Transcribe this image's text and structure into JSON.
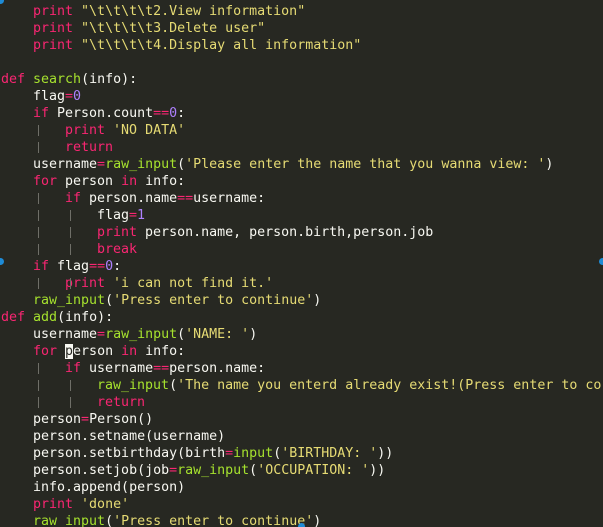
{
  "lines": [
    {
      "indent": 1,
      "guides": [],
      "tokens": [
        {
          "t": "print ",
          "c": "kw"
        },
        {
          "t": "\"\\t\\t\\t\\t2.View information\"",
          "c": "str"
        }
      ]
    },
    {
      "indent": 1,
      "guides": [],
      "tokens": [
        {
          "t": "print ",
          "c": "kw"
        },
        {
          "t": "\"\\t\\t\\t\\t3.Delete user\"",
          "c": "str"
        }
      ]
    },
    {
      "indent": 1,
      "guides": [],
      "tokens": [
        {
          "t": "print ",
          "c": "kw"
        },
        {
          "t": "\"\\t\\t\\t\\t4.Display all information\"",
          "c": "str"
        }
      ]
    },
    {
      "indent": 0,
      "guides": [],
      "tokens": []
    },
    {
      "indent": 0,
      "guides": [],
      "tokens": [
        {
          "t": "def ",
          "c": "kw"
        },
        {
          "t": "search",
          "c": "fn"
        },
        {
          "t": "(info):",
          "c": ""
        }
      ]
    },
    {
      "indent": 1,
      "guides": [],
      "tokens": [
        {
          "t": "flag",
          "c": ""
        },
        {
          "t": "=",
          "c": "kw"
        },
        {
          "t": "0",
          "c": "num"
        }
      ]
    },
    {
      "indent": 1,
      "guides": [],
      "tokens": [
        {
          "t": "if ",
          "c": "kw"
        },
        {
          "t": "Person.count",
          "c": ""
        },
        {
          "t": "==",
          "c": "kw"
        },
        {
          "t": "0",
          "c": "num"
        },
        {
          "t": ":",
          "c": ""
        }
      ]
    },
    {
      "indent": 2,
      "guides": [
        1
      ],
      "tokens": [
        {
          "t": "print ",
          "c": "kw"
        },
        {
          "t": "'NO DATA'",
          "c": "str"
        }
      ]
    },
    {
      "indent": 2,
      "guides": [
        1
      ],
      "tokens": [
        {
          "t": "return",
          "c": "kw"
        }
      ]
    },
    {
      "indent": 1,
      "guides": [],
      "tokens": [
        {
          "t": "username",
          "c": ""
        },
        {
          "t": "=",
          "c": "kw"
        },
        {
          "t": "raw_input",
          "c": "bi"
        },
        {
          "t": "(",
          "c": ""
        },
        {
          "t": "'Please enter the name that you wanna view: '",
          "c": "str"
        },
        {
          "t": ")",
          "c": ""
        }
      ]
    },
    {
      "indent": 1,
      "guides": [],
      "tokens": [
        {
          "t": "for ",
          "c": "kw"
        },
        {
          "t": "person ",
          "c": ""
        },
        {
          "t": "in ",
          "c": "kw"
        },
        {
          "t": "info:",
          "c": ""
        }
      ]
    },
    {
      "indent": 2,
      "guides": [
        1
      ],
      "tokens": [
        {
          "t": "if ",
          "c": "kw"
        },
        {
          "t": "person.name",
          "c": ""
        },
        {
          "t": "==",
          "c": "kw"
        },
        {
          "t": "username:",
          "c": ""
        }
      ]
    },
    {
      "indent": 3,
      "guides": [
        1,
        2
      ],
      "tokens": [
        {
          "t": "flag",
          "c": ""
        },
        {
          "t": "=",
          "c": "kw"
        },
        {
          "t": "1",
          "c": "num"
        }
      ]
    },
    {
      "indent": 3,
      "guides": [
        1,
        2
      ],
      "tokens": [
        {
          "t": "print ",
          "c": "kw"
        },
        {
          "t": "person.name, person.birth,person.job",
          "c": ""
        }
      ]
    },
    {
      "indent": 3,
      "guides": [
        1,
        2
      ],
      "tokens": [
        {
          "t": "break",
          "c": "kw"
        }
      ]
    },
    {
      "indent": 1,
      "guides": [],
      "tokens": [
        {
          "t": "if ",
          "c": "kw"
        },
        {
          "t": "flag",
          "c": ""
        },
        {
          "t": "==",
          "c": "kw"
        },
        {
          "t": "0",
          "c": "num"
        },
        {
          "t": ":",
          "c": ""
        }
      ]
    },
    {
      "indent": 2,
      "guides": [
        1,
        2
      ],
      "tokens": [
        {
          "t": "print ",
          "c": "kw"
        },
        {
          "t": "'i can not find it.'",
          "c": "str"
        }
      ]
    },
    {
      "indent": 1,
      "guides": [],
      "tokens": [
        {
          "t": "raw_input",
          "c": "bi"
        },
        {
          "t": "(",
          "c": ""
        },
        {
          "t": "'Press enter to continue'",
          "c": "str"
        },
        {
          "t": ")",
          "c": ""
        }
      ]
    },
    {
      "indent": 0,
      "guides": [],
      "tokens": [
        {
          "t": "def ",
          "c": "kw"
        },
        {
          "t": "add",
          "c": "fn"
        },
        {
          "t": "(info):",
          "c": ""
        }
      ]
    },
    {
      "indent": 1,
      "guides": [],
      "tokens": [
        {
          "t": "username",
          "c": ""
        },
        {
          "t": "=",
          "c": "kw"
        },
        {
          "t": "raw_input",
          "c": "bi"
        },
        {
          "t": "(",
          "c": ""
        },
        {
          "t": "'NAME: '",
          "c": "str"
        },
        {
          "t": ")",
          "c": ""
        }
      ]
    },
    {
      "indent": 1,
      "guides": [],
      "tokens": [
        {
          "t": "for ",
          "c": "kw"
        },
        {
          "t": "p",
          "c": "cursor"
        },
        {
          "t": "erson ",
          "c": ""
        },
        {
          "t": "in ",
          "c": "kw"
        },
        {
          "t": "info:",
          "c": ""
        }
      ]
    },
    {
      "indent": 2,
      "guides": [
        1
      ],
      "tokens": [
        {
          "t": "if ",
          "c": "kw"
        },
        {
          "t": "username",
          "c": ""
        },
        {
          "t": "==",
          "c": "kw"
        },
        {
          "t": "person.name:",
          "c": ""
        }
      ]
    },
    {
      "indent": 3,
      "guides": [
        1,
        2
      ],
      "tokens": [
        {
          "t": "raw_input",
          "c": "bi"
        },
        {
          "t": "(",
          "c": ""
        },
        {
          "t": "'The name you enterd already exist!(Press enter to co",
          "c": "str"
        }
      ]
    },
    {
      "indent": 3,
      "guides": [
        1,
        2
      ],
      "tokens": [
        {
          "t": "return",
          "c": "kw"
        }
      ]
    },
    {
      "indent": 1,
      "guides": [],
      "tokens": [
        {
          "t": "person",
          "c": ""
        },
        {
          "t": "=",
          "c": "kw"
        },
        {
          "t": "Person()",
          "c": ""
        }
      ]
    },
    {
      "indent": 1,
      "guides": [],
      "tokens": [
        {
          "t": "person.setname(username)",
          "c": ""
        }
      ]
    },
    {
      "indent": 1,
      "guides": [],
      "tokens": [
        {
          "t": "person.setbirthday(birth",
          "c": ""
        },
        {
          "t": "=",
          "c": "kw"
        },
        {
          "t": "input",
          "c": "bi"
        },
        {
          "t": "(",
          "c": ""
        },
        {
          "t": "'BIRTHDAY: '",
          "c": "str"
        },
        {
          "t": "))",
          "c": ""
        }
      ]
    },
    {
      "indent": 1,
      "guides": [],
      "tokens": [
        {
          "t": "person.setjob(job",
          "c": ""
        },
        {
          "t": "=",
          "c": "kw"
        },
        {
          "t": "raw_input",
          "c": "bi"
        },
        {
          "t": "(",
          "c": ""
        },
        {
          "t": "'OCCUPATION: '",
          "c": "str"
        },
        {
          "t": "))",
          "c": ""
        }
      ]
    },
    {
      "indent": 1,
      "guides": [],
      "tokens": [
        {
          "t": "info.append(person)",
          "c": ""
        }
      ]
    },
    {
      "indent": 1,
      "guides": [],
      "tokens": [
        {
          "t": "print ",
          "c": "kw"
        },
        {
          "t": "'done'",
          "c": "str"
        }
      ]
    },
    {
      "indent": 1,
      "guides": [],
      "tokens": [
        {
          "t": "raw_input",
          "c": "bi"
        },
        {
          "t": "(",
          "c": ""
        },
        {
          "t": "'Press enter to continue'",
          "c": "str"
        },
        {
          "t": ")",
          "c": ""
        }
      ]
    }
  ],
  "colors": {
    "background": "#272822",
    "keyword": "#f92672",
    "function": "#a6e22e",
    "string": "#e6db74",
    "number": "#ae81ff",
    "text": "#f8f8f2",
    "selection_handle": "#1e8bd6"
  }
}
